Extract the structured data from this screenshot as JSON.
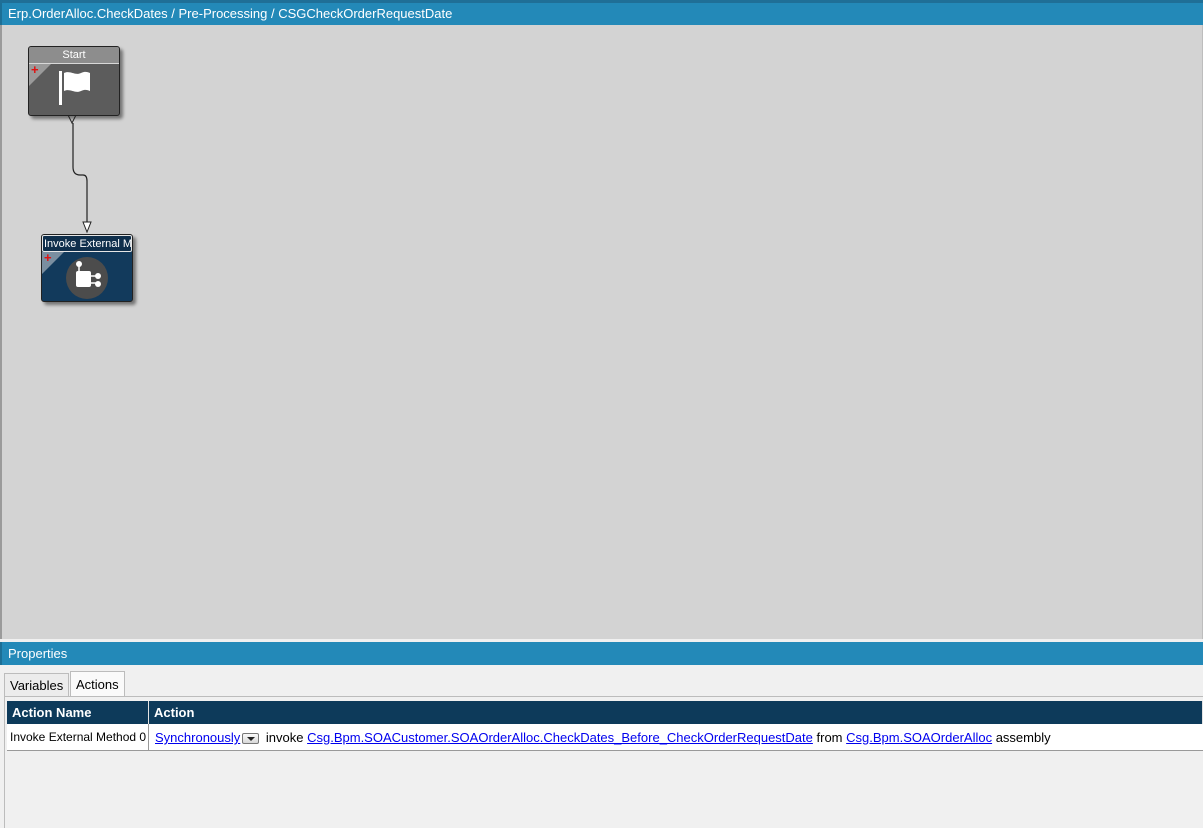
{
  "window": {
    "breadcrumb": "Erp.OrderAlloc.CheckDates / Pre-Processing / CSGCheckOrderRequestDate"
  },
  "workflow": {
    "nodes": [
      {
        "label": "Start",
        "icon": "flag-icon"
      },
      {
        "label": "Invoke External Me",
        "icon": "external-method-icon"
      }
    ]
  },
  "properties": {
    "title": "Properties",
    "tabs": [
      {
        "label": "Variables",
        "active": false
      },
      {
        "label": "Actions",
        "active": true
      }
    ],
    "grid": {
      "columns": [
        "Action Name",
        "Action"
      ],
      "rows": [
        {
          "action_name": "Invoke External Method 0",
          "mode_link": "Synchronously",
          "verb": "invoke",
          "method_link": "Csg.Bpm.SOACustomer.SOAOrderAlloc.CheckDates_Before_CheckOrderRequestDate",
          "from_text": "from",
          "assembly_link": "Csg.Bpm.SOAOrderAlloc",
          "assembly_text": "assembly"
        }
      ]
    }
  },
  "colors": {
    "header_blue": "#2389b8",
    "canvas_gray": "#d3d3d3",
    "grid_header": "#0d3a5a",
    "start_node": "#5c5c5c",
    "invoke_node": "#123a5c"
  }
}
